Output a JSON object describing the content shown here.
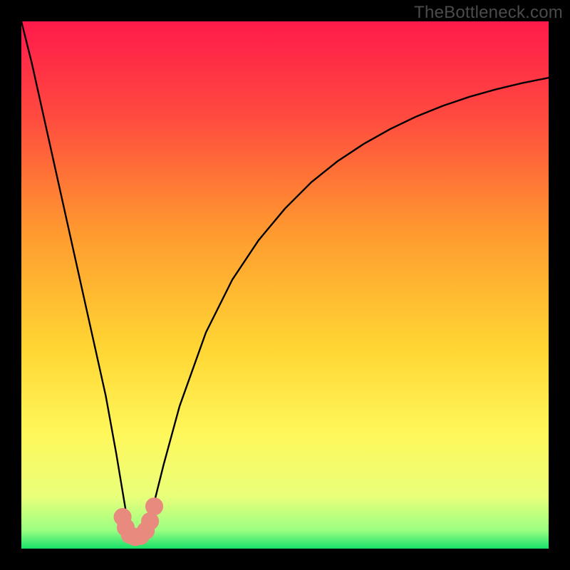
{
  "watermark": "TheBottleneck.com",
  "chart_data": {
    "type": "line",
    "title": "",
    "xlabel": "",
    "ylabel": "",
    "xlim": [
      0,
      100
    ],
    "ylim": [
      0,
      100
    ],
    "gradient_stops": [
      {
        "offset": 0,
        "color": "#ff1a4b"
      },
      {
        "offset": 0.18,
        "color": "#ff4a3f"
      },
      {
        "offset": 0.4,
        "color": "#ff9a2f"
      },
      {
        "offset": 0.62,
        "color": "#ffd633"
      },
      {
        "offset": 0.78,
        "color": "#fff75a"
      },
      {
        "offset": 0.9,
        "color": "#eaff7a"
      },
      {
        "offset": 0.965,
        "color": "#9bff82"
      },
      {
        "offset": 1.0,
        "color": "#18e06a"
      }
    ],
    "series": [
      {
        "name": "notch-curve",
        "color": "#000000",
        "stroke_width": 2.4,
        "x": [
          0.0,
          2.0,
          4.0,
          6.0,
          8.0,
          10.0,
          12.0,
          14.0,
          16.0,
          18.0,
          19.0,
          20.0,
          21.0,
          22.0,
          23.0,
          24.0,
          25.0,
          27.0,
          30.0,
          35.0,
          40.0,
          45.0,
          50.0,
          55.0,
          60.0,
          65.0,
          70.0,
          75.0,
          80.0,
          85.0,
          90.0,
          95.0,
          100.0
        ],
        "y": [
          100.0,
          92.0,
          83.0,
          74.0,
          65.0,
          56.0,
          47.0,
          38.0,
          29.0,
          18.0,
          12.0,
          6.0,
          2.5,
          2.0,
          2.5,
          4.5,
          8.0,
          16.0,
          27.0,
          41.0,
          51.0,
          58.5,
          64.5,
          69.5,
          73.5,
          76.8,
          79.6,
          82.0,
          84.0,
          85.7,
          87.1,
          88.3,
          89.3
        ]
      }
    ],
    "markers": {
      "name": "valley-markers",
      "comment": "Rounded salmon markers near the notch bottom at ~3% height",
      "color": "#e98a7e",
      "radius_pct": 1.7,
      "points": [
        {
          "x": 19.2,
          "y": 6.0
        },
        {
          "x": 19.8,
          "y": 4.0
        },
        {
          "x": 20.6,
          "y": 2.6
        },
        {
          "x": 21.6,
          "y": 2.2
        },
        {
          "x": 22.6,
          "y": 2.4
        },
        {
          "x": 23.6,
          "y": 3.4
        },
        {
          "x": 24.4,
          "y": 5.2
        },
        {
          "x": 25.2,
          "y": 8.0
        }
      ]
    }
  }
}
